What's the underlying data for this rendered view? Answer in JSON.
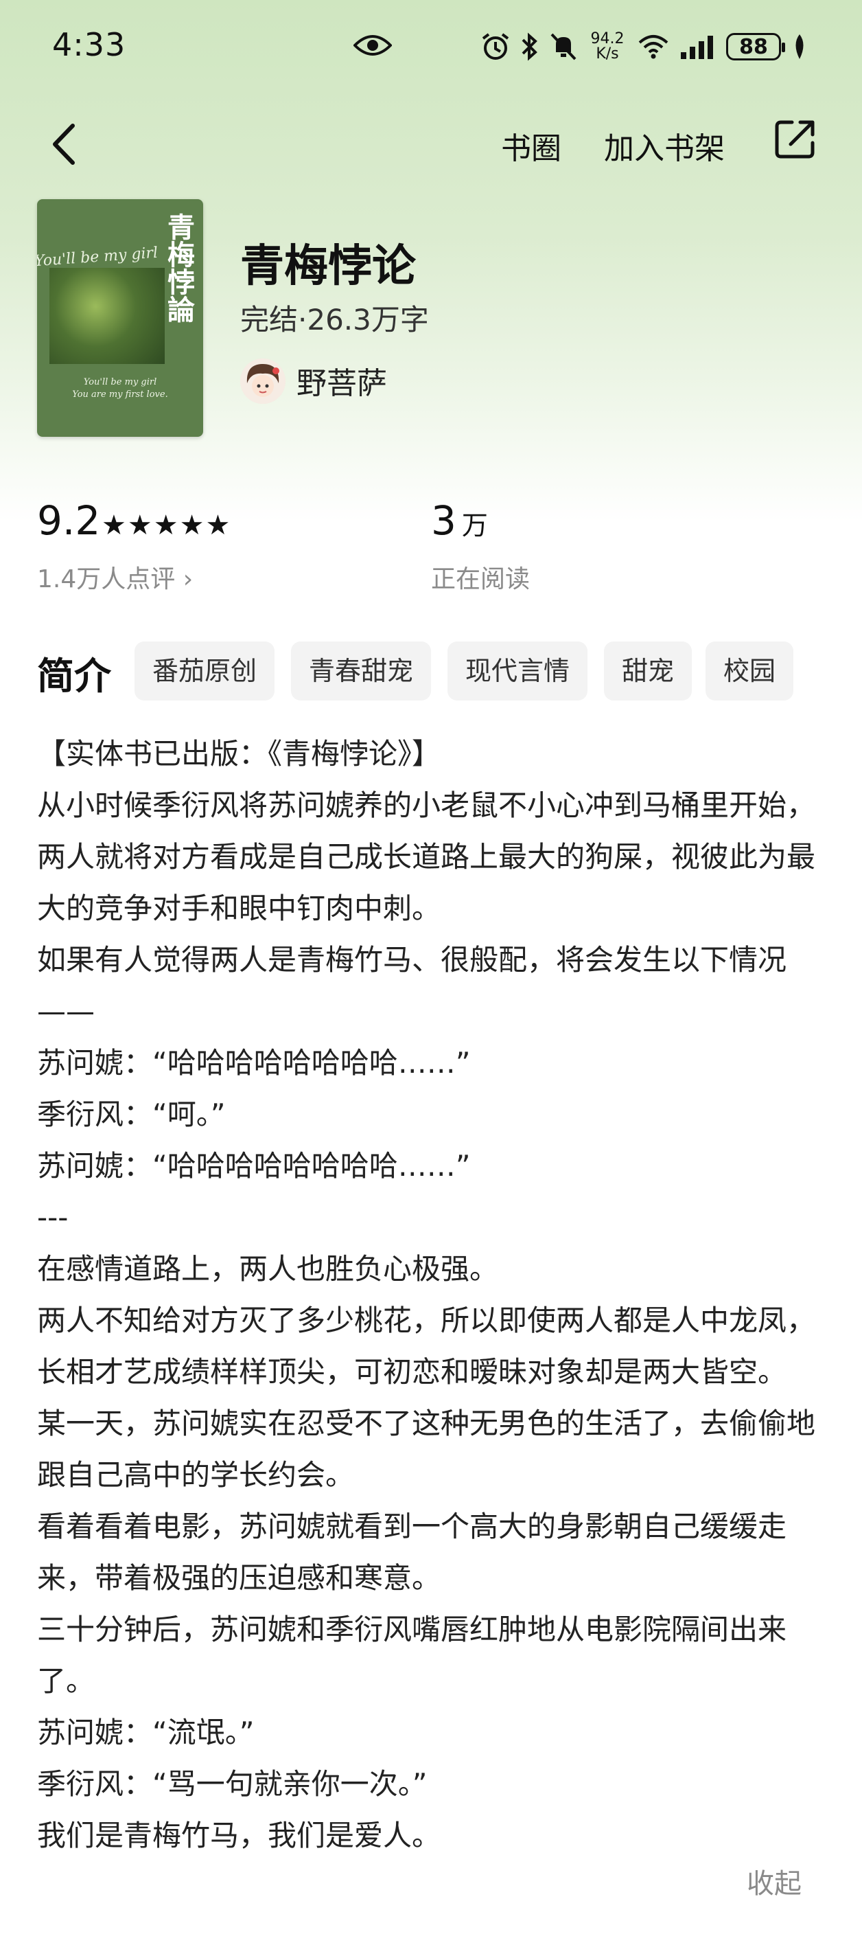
{
  "status_bar": {
    "time": "4:33",
    "net_speed_value": "94.2",
    "net_speed_unit": "K/s",
    "battery": "88",
    "icons": [
      "eye-icon",
      "alarm-icon",
      "bluetooth-icon",
      "mute-icon",
      "wifi-icon",
      "signal-icon",
      "leaf-icon"
    ]
  },
  "nav": {
    "back_icon": "chevron-left-icon",
    "circle_label": "书圈",
    "add_shelf_label": "加入书架",
    "share_icon": "share-icon"
  },
  "cover": {
    "title": "青梅悖論",
    "script_text": "You'll be my girl",
    "caption_line1": "You'll be my girl",
    "caption_line2": "You are my first love."
  },
  "book": {
    "title": "青梅悖论",
    "meta": "完结·26.3万字",
    "author": "野菩萨"
  },
  "stats": {
    "rating": "9.2",
    "stars": "★★★★★",
    "review_count": "1.4万人点评 ›",
    "readers": "3",
    "readers_unit": "万",
    "readers_label": "正在阅读"
  },
  "intro": {
    "label": "简介",
    "tags": [
      "番茄原创",
      "青春甜宠",
      "现代言情",
      "甜宠",
      "校园"
    ]
  },
  "description": [
    "【实体书已出版：《青梅悖论》】",
    "从小时候季衍风将苏问婋养的小老鼠不小心冲到马桶里开始，两人就将对方看成是自己成长道路上最大的狗屎，视彼此为最大的竞争对手和眼中钉肉中刺。",
    "如果有人觉得两人是青梅竹马、很般配，将会发生以下情况——",
    "苏问婋：“哈哈哈哈哈哈哈哈……”",
    "季衍风：“呵。”",
    "苏问婋：“哈哈哈哈哈哈哈哈……”",
    "---",
    "在感情道路上，两人也胜负心极强。",
    "两人不知给对方灭了多少桃花，所以即使两人都是人中龙凤，长相才艺成绩样样顶尖，可初恋和暧昧对象却是两大皆空。",
    "某一天，苏问婋实在忍受不了这种无男色的生活了，去偷偷地跟自己高中的学长约会。",
    "看着看着电影，苏问婋就看到一个高大的身影朝自己缓缓走来，带着极强的压迫感和寒意。",
    "三十分钟后，苏问婋和季衍风嘴唇红肿地从电影院隔间出来了。",
    "苏问婋：“流氓。”",
    "季衍风：“骂一句就亲你一次。”",
    "我们是青梅竹马，我们是爱人。"
  ],
  "collapse_label": "收起"
}
